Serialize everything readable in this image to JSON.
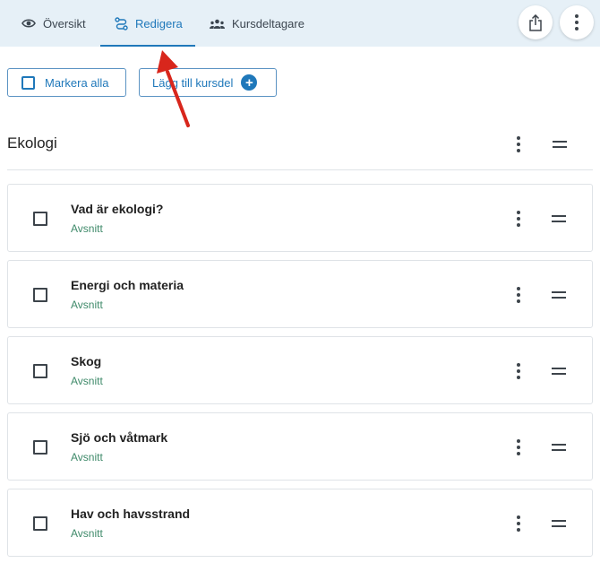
{
  "tabs": [
    {
      "label": "Översikt",
      "icon": "eye-icon",
      "active": false
    },
    {
      "label": "Redigera",
      "icon": "route-icon",
      "active": true
    },
    {
      "label": "Kursdeltagare",
      "icon": "people-icon",
      "active": false
    }
  ],
  "header_actions": {
    "share_icon": "share-icon",
    "more_icon": "more-vertical-icon"
  },
  "toolbar": {
    "select_all_label": "Markera alla",
    "add_part_label": "Lägg till kursdel"
  },
  "section": {
    "title": "Ekologi"
  },
  "items": [
    {
      "title": "Vad är ekologi?",
      "type": "Avsnitt"
    },
    {
      "title": "Energi och materia",
      "type": "Avsnitt"
    },
    {
      "title": "Skog",
      "type": "Avsnitt"
    },
    {
      "title": "Sjö och våtmark",
      "type": "Avsnitt"
    },
    {
      "title": "Hav och havsstrand",
      "type": "Avsnitt"
    }
  ],
  "colors": {
    "accent": "#1f78ba",
    "topbar": "#e6f0f7",
    "subtitle": "#3f8a6a",
    "annotation_arrow": "#d8261c"
  }
}
